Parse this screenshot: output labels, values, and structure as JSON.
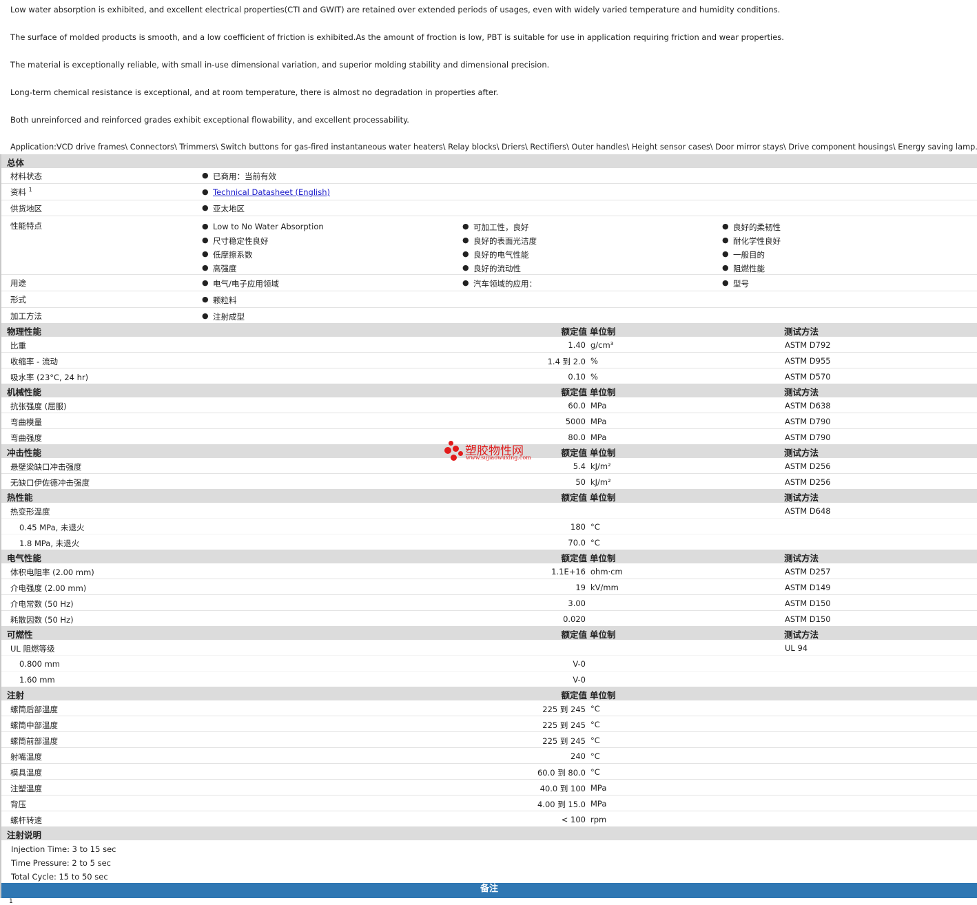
{
  "intro": [
    "Low water absorption is exhibited, and excellent electrical properties(CTI and GWIT) are retained over extended periods of usages, even with widely varied temperature and humidity conditions.",
    "The surface of molded products is smooth, and a low coefficient of friction is exhibited.As the amount of froction is low, PBT is suitable for use in application requiring friction and wear properties.",
    "The material is exceptionally reliable, with small in-use dimensional variation, and superior molding stability and dimensional precision.",
    "Long-term chemical resistance is exceptional, and at room temperature, there is almost no degradation in properties after.",
    "Both unreinforced and reinforced grades exhibit exceptional flowability, and excellent processability.",
    "Application:VCD drive frames\\ Connectors\\ Trimmers\\ Switch buttons for gas-fired instantaneous water heaters\\ Relay blocks\\ Driers\\ Rectifiers\\ Outer handles\\ Height sensor cases\\ Door mirror stays\\ Drive component housings\\ Energy saving lamp."
  ],
  "general": {
    "title": "总体",
    "status_label": "材料状态",
    "status_value": "已商用：当前有效",
    "info_label": "资料",
    "info_sup": "1",
    "info_link": "Technical Datasheet (English)",
    "region_label": "供货地区",
    "region_value": "亚太地区",
    "features_label": "性能特点",
    "features_col1": [
      "Low to No Water Absorption",
      "尺寸稳定性良好",
      "低摩擦系数",
      "高强度"
    ],
    "features_col2": [
      "可加工性，良好",
      "良好的表面光洁度",
      "良好的电气性能",
      "良好的流动性"
    ],
    "features_col3": [
      "良好的柔韧性",
      "耐化学性良好",
      "一般目的",
      "阻燃性能"
    ],
    "uses_label": "用途",
    "uses": [
      "电气/电子应用领域",
      "汽车领域的应用：",
      "型号"
    ],
    "form_label": "形式",
    "form_value": "颗粒料",
    "process_label": "加工方法",
    "process_value": "注射成型"
  },
  "headers": {
    "value": "额定值",
    "unit": "单位制",
    "method": "测试方法"
  },
  "physical": {
    "title": "物理性能",
    "rows": [
      {
        "name": "比重",
        "value": "1.40",
        "unit": "g/cm³",
        "method": "ASTM D792"
      },
      {
        "name": "收缩率  - 流动",
        "value": "1.4 到  2.0",
        "unit": "%",
        "method": "ASTM D955"
      },
      {
        "name": "吸水率  (23°C, 24 hr)",
        "value": "0.10",
        "unit": "%",
        "method": "ASTM D570"
      }
    ]
  },
  "mechanical": {
    "title": "机械性能",
    "rows": [
      {
        "name": "抗张强度  (屈服)",
        "value": "60.0",
        "unit": "MPa",
        "method": "ASTM D638"
      },
      {
        "name": "弯曲模量",
        "value": "5000",
        "unit": "MPa",
        "method": "ASTM D790"
      },
      {
        "name": "弯曲强度",
        "value": "80.0",
        "unit": "MPa",
        "method": "ASTM D790"
      }
    ]
  },
  "impact": {
    "title": "冲击性能",
    "rows": [
      {
        "name": "悬壁梁缺口冲击强度",
        "value": "5.4",
        "unit": "kJ/m²",
        "method": "ASTM D256"
      },
      {
        "name": "无缺口伊佐德冲击强度",
        "value": "50",
        "unit": "kJ/m²",
        "method": "ASTM D256"
      }
    ]
  },
  "thermal": {
    "title": "热性能",
    "hdt_label": "热变形温度",
    "hdt_method": "ASTM D648",
    "rows": [
      {
        "name": "0.45 MPa, 未退火",
        "value": "180",
        "unit": "°C"
      },
      {
        "name": "1.8 MPa, 未退火",
        "value": "70.0",
        "unit": "°C"
      }
    ]
  },
  "electrical": {
    "title": "电气性能",
    "rows": [
      {
        "name": "体积电阻率  (2.00 mm)",
        "value": "1.1E+16",
        "unit": "ohm·cm",
        "method": "ASTM D257"
      },
      {
        "name": "介电强度  (2.00 mm)",
        "value": "19",
        "unit": "kV/mm",
        "method": "ASTM D149"
      },
      {
        "name": "介电常数  (50 Hz)",
        "value": "3.00",
        "unit": "",
        "method": "ASTM D150"
      },
      {
        "name": "耗散因数  (50 Hz)",
        "value": "0.020",
        "unit": "",
        "method": "ASTM D150"
      }
    ]
  },
  "flammability": {
    "title": "可燃性",
    "ul_label": "UL 阻燃等级",
    "ul_method": "UL 94",
    "rows": [
      {
        "name": "0.800 mm",
        "value": "V-0"
      },
      {
        "name": "1.60 mm",
        "value": "V-0"
      }
    ]
  },
  "injection": {
    "title": "注射",
    "rows": [
      {
        "name": "螺筒后部温度",
        "value": "225 到  245",
        "unit": "°C"
      },
      {
        "name": "螺筒中部温度",
        "value": "225 到  245",
        "unit": "°C"
      },
      {
        "name": "螺筒前部温度",
        "value": "225 到  245",
        "unit": "°C"
      },
      {
        "name": "射嘴温度",
        "value": "240",
        "unit": "°C"
      },
      {
        "name": "模具温度",
        "value": "60.0 到  80.0",
        "unit": "°C"
      },
      {
        "name": "注塑温度",
        "value": "40.0 到  100",
        "unit": "MPa"
      },
      {
        "name": "背压",
        "value": "4.00 到  15.0",
        "unit": "MPa"
      },
      {
        "name": "螺杆转速",
        "value": "< 100",
        "unit": "rpm"
      }
    ]
  },
  "injection_notes": {
    "title": "注射说明",
    "lines": [
      "Injection Time: 3 to 15 sec",
      "Time Pressure: 2 to 5 sec",
      "Total Cycle: 15 to 50 sec"
    ]
  },
  "remarks": {
    "title": "备注",
    "footnote": "1"
  },
  "watermark": {
    "cn": "塑胶物性网",
    "en": "www.sujiaowuxing.com",
    "color": "#e21c1c"
  }
}
